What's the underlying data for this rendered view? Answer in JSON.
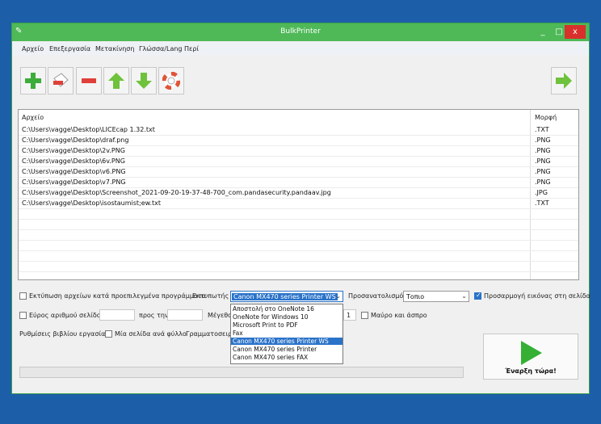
{
  "window": {
    "title": "BulkPrinter",
    "minimize": "_",
    "maximize": "□",
    "close": "x"
  },
  "menu": [
    "Αρχείο",
    "Επεξεργασία",
    "Μετακίνηση",
    "Γλώσσα/Lang",
    "Περί"
  ],
  "toolbar": [
    "add-icon",
    "remove-icon",
    "clear-icon",
    "move-up-icon",
    "move-down-icon",
    "help-icon",
    "next-icon"
  ],
  "filelist": {
    "col_file": "Αρχείο",
    "col_format": "Μορφή",
    "rows": [
      {
        "path": "C:\\Users\\vagge\\Desktop\\LICEcap 1.32.txt",
        "ext": ".TXT"
      },
      {
        "path": "C:\\Users\\vagge\\Desktop\\draf.png",
        "ext": ".PNG"
      },
      {
        "path": "C:\\Users\\vagge\\Desktop\\2v.PNG",
        "ext": ".PNG"
      },
      {
        "path": "C:\\Users\\vagge\\Desktop\\6v.PNG",
        "ext": ".PNG"
      },
      {
        "path": "C:\\Users\\vagge\\Desktop\\v6.PNG",
        "ext": ".PNG"
      },
      {
        "path": "C:\\Users\\vagge\\Desktop\\v7.PNG",
        "ext": ".PNG"
      },
      {
        "path": "C:\\Users\\vagge\\Desktop\\Screenshot_2021-09-20-19-37-48-700_com.pandasecurity.pandaav.jpg",
        "ext": ".JPG"
      },
      {
        "path": "C:\\Users\\vagge\\Desktop\\isostaumist;ew.txt",
        "ext": ".TXT"
      }
    ]
  },
  "options": {
    "print_default_programs": "Εκτύπωση αρχείων κατά προεπιλεγμένα προγράμματα",
    "printer_label": "Εκτυπωτής",
    "printer_value": "Canon MX470 series Printer WS",
    "orientation_label": "Προσανατολισμός",
    "orientation_value": "Τοπιο",
    "fit_image": "Προσαρμογή εικόνας στη σελίδα",
    "page_range": "Εύρος αριθμού σελίδος",
    "to_label": "προς την",
    "size_label": "Μέγεθο",
    "size_value": "1",
    "black_white": "Μαύρο και άσπρο",
    "workbook_settings": "Ρυθμίσεις βιβλίου εργασίας:",
    "one_page_per_sheet": "Μία σελίδα ανά φύλλο",
    "gridlines_label": "Γραμματοσειρά"
  },
  "printer_dropdown": [
    "Αποστολή στο OneNote 16",
    "OneNote for Windows 10",
    "Microsoft Print to PDF",
    "Fax",
    "Canon MX470 series Printer WS",
    "Canon MX470 series Printer",
    "Canon MX470 series FAX"
  ],
  "start_button": "Έναρξη τώρα!"
}
